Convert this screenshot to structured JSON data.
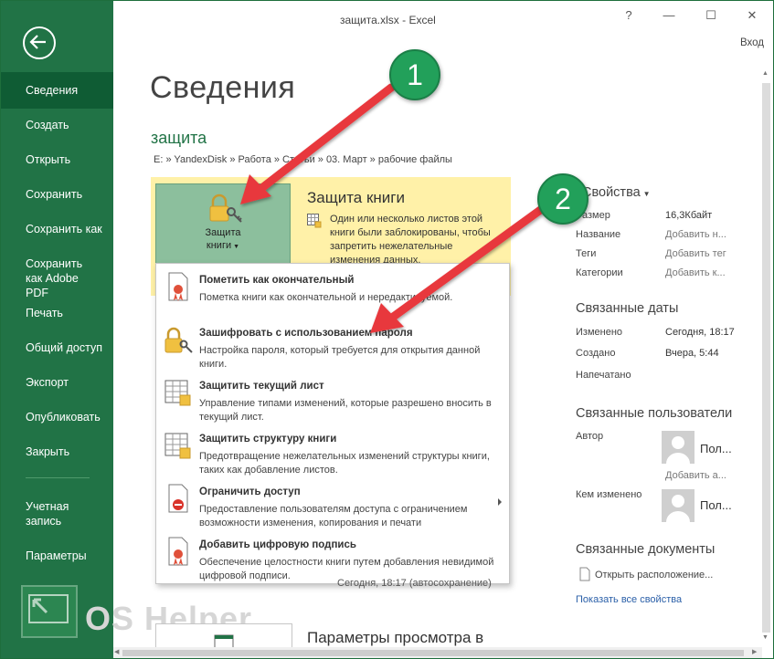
{
  "window": {
    "title": "защита.xlsx - Excel",
    "help": "?",
    "minimize": "—",
    "maximize": "☐",
    "close": "✕",
    "signin": "Вход"
  },
  "sidebar": {
    "items": [
      {
        "label": "Сведения"
      },
      {
        "label": "Создать"
      },
      {
        "label": "Открыть"
      },
      {
        "label": "Сохранить"
      },
      {
        "label": "Сохранить как"
      },
      {
        "label": "Сохранить как Adobe PDF"
      },
      {
        "label": "Печать"
      },
      {
        "label": "Общий доступ"
      },
      {
        "label": "Экспорт"
      },
      {
        "label": "Опубликовать"
      },
      {
        "label": "Закрыть"
      },
      {
        "label": "Учетная запись"
      },
      {
        "label": "Параметры"
      }
    ]
  },
  "main": {
    "page_title": "Сведения",
    "file_name": "защита",
    "file_path": "E: » YandexDisk » Работа » Статьи » 03. Март » рабочие файлы",
    "protect": {
      "button_line1": "Защита",
      "button_line2": "книги",
      "title": "Защита книги",
      "description": "Один или несколько листов этой книги были заблокированы, чтобы запретить нежелательные изменения данных."
    },
    "menu": [
      {
        "title": "Пометить как окончательный",
        "desc": "Пометка книги как окончательной и нередактируемой."
      },
      {
        "title": "Зашифровать с использованием пароля",
        "desc": "Настройка пароля, который требуется для открытия данной книги."
      },
      {
        "title": "Защитить текущий лист",
        "desc": "Управление типами изменений, которые разрешено вносить в текущий лист."
      },
      {
        "title": "Защитить структуру книги",
        "desc": "Предотвращение нежелательных изменений структуры книги, таких как добавление листов."
      },
      {
        "title": "Ограничить доступ",
        "desc": "Предоставление пользователям доступа с ограничением возможности изменения, копирования и печати"
      },
      {
        "title": "Добавить цифровую подпись",
        "desc": "Обеспечение целостности книги путем добавления невидимой цифровой подписи."
      }
    ],
    "behind_text": "Сегодня, 18:17 (автосохранение)",
    "view_params_title": "Параметры просмотра в"
  },
  "properties": {
    "heading": "Свойства",
    "rows": [
      {
        "label": "Размер",
        "value": "16,3Кбайт"
      },
      {
        "label": "Название",
        "value": "Добавить н..."
      },
      {
        "label": "Теги",
        "value": "Добавить тег"
      },
      {
        "label": "Категории",
        "value": "Добавить к..."
      }
    ],
    "dates_heading": "Связанные даты",
    "dates": [
      {
        "label": "Изменено",
        "value": "Сегодня, 18:17"
      },
      {
        "label": "Создано",
        "value": "Вчера, 5:44"
      },
      {
        "label": "Напечатано",
        "value": ""
      }
    ],
    "users_heading": "Связанные пользователи",
    "author_label": "Автор",
    "author_name": "Пол...",
    "add_author": "Добавить а...",
    "modified_by_label": "Кем изменено",
    "modified_by_name": "Пол...",
    "docs_heading": "Связанные документы",
    "open_location": "Открыть расположение...",
    "show_all": "Показать все свойства"
  },
  "annotations": {
    "callout1": "1",
    "callout2": "2",
    "arrow_color": "#e8383d",
    "callout_color": "#22a05a"
  },
  "watermark": "OS Helper",
  "colors": {
    "sidebar": "#217346",
    "sidebar_active": "#0f5c34",
    "protect_panel": "#fff1a8",
    "protect_button": "#8cbf9d"
  }
}
